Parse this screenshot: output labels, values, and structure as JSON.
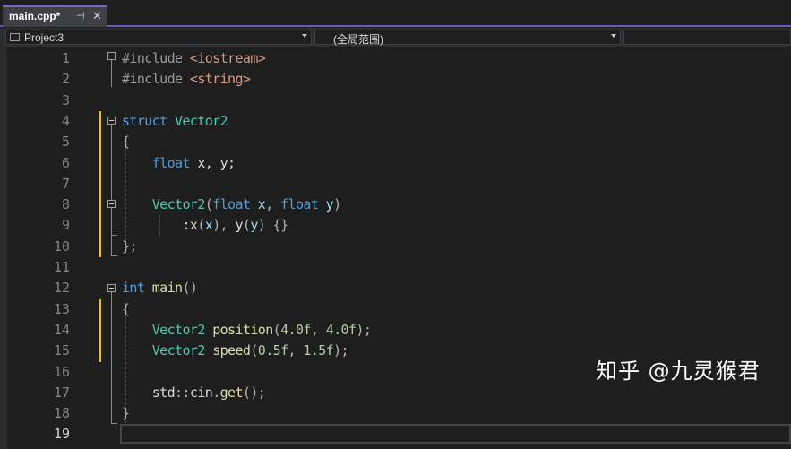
{
  "tab": {
    "title": "main.cpp*",
    "pin_icon": "pin-icon",
    "close_glyph": "✕"
  },
  "nav": {
    "project": "Project3",
    "scope": "(全局范围)"
  },
  "lines": [
    {
      "n": "1",
      "tokens": [
        {
          "c": "pre",
          "t": "#include "
        },
        {
          "c": "str",
          "t": "<iostream>"
        }
      ]
    },
    {
      "n": "2",
      "tokens": [
        {
          "c": "pre",
          "t": "#include "
        },
        {
          "c": "str",
          "t": "<string>"
        }
      ]
    },
    {
      "n": "3",
      "tokens": []
    },
    {
      "n": "4",
      "tokens": [
        {
          "c": "kw",
          "t": "struct "
        },
        {
          "c": "type",
          "t": "Vector2"
        }
      ]
    },
    {
      "n": "5",
      "tokens": [
        {
          "c": "punc",
          "t": "{"
        }
      ]
    },
    {
      "n": "6",
      "tokens": [
        {
          "c": "txt",
          "t": "    "
        },
        {
          "c": "kw",
          "t": "float"
        },
        {
          "c": "txt",
          "t": " x, y;"
        }
      ]
    },
    {
      "n": "7",
      "tokens": []
    },
    {
      "n": "8",
      "tokens": [
        {
          "c": "txt",
          "t": "    "
        },
        {
          "c": "type",
          "t": "Vector2"
        },
        {
          "c": "punc",
          "t": "("
        },
        {
          "c": "kw",
          "t": "float"
        },
        {
          "c": "par",
          "t": " x"
        },
        {
          "c": "punc",
          "t": ", "
        },
        {
          "c": "kw",
          "t": "float"
        },
        {
          "c": "par",
          "t": " y"
        },
        {
          "c": "punc",
          "t": ")"
        }
      ]
    },
    {
      "n": "9",
      "tokens": [
        {
          "c": "txt",
          "t": "        :x"
        },
        {
          "c": "punc",
          "t": "("
        },
        {
          "c": "par",
          "t": "x"
        },
        {
          "c": "punc",
          "t": "), "
        },
        {
          "c": "txt",
          "t": "y"
        },
        {
          "c": "punc",
          "t": "("
        },
        {
          "c": "par",
          "t": "y"
        },
        {
          "c": "punc",
          "t": ") {}"
        }
      ]
    },
    {
      "n": "10",
      "tokens": [
        {
          "c": "punc",
          "t": "};"
        }
      ]
    },
    {
      "n": "11",
      "tokens": []
    },
    {
      "n": "12",
      "tokens": [
        {
          "c": "kw",
          "t": "int "
        },
        {
          "c": "fn",
          "t": "main"
        },
        {
          "c": "punc",
          "t": "()"
        }
      ]
    },
    {
      "n": "13",
      "tokens": [
        {
          "c": "punc",
          "t": "{"
        }
      ]
    },
    {
      "n": "14",
      "tokens": [
        {
          "c": "txt",
          "t": "    "
        },
        {
          "c": "type",
          "t": "Vector2"
        },
        {
          "c": "txt",
          "t": " "
        },
        {
          "c": "fn",
          "t": "position"
        },
        {
          "c": "punc",
          "t": "("
        },
        {
          "c": "num",
          "t": "4.0f"
        },
        {
          "c": "punc",
          "t": ", "
        },
        {
          "c": "num",
          "t": "4.0f"
        },
        {
          "c": "punc",
          "t": ");"
        }
      ]
    },
    {
      "n": "15",
      "tokens": [
        {
          "c": "txt",
          "t": "    "
        },
        {
          "c": "type",
          "t": "Vector2"
        },
        {
          "c": "txt",
          "t": " "
        },
        {
          "c": "fn",
          "t": "speed"
        },
        {
          "c": "punc",
          "t": "("
        },
        {
          "c": "num",
          "t": "0.5f"
        },
        {
          "c": "punc",
          "t": ", "
        },
        {
          "c": "num",
          "t": "1.5f"
        },
        {
          "c": "punc",
          "t": ");"
        }
      ]
    },
    {
      "n": "16",
      "tokens": []
    },
    {
      "n": "17",
      "tokens": [
        {
          "c": "txt",
          "t": "    std"
        },
        {
          "c": "punc",
          "t": "::"
        },
        {
          "c": "txt",
          "t": "cin"
        },
        {
          "c": "punc",
          "t": "."
        },
        {
          "c": "fn",
          "t": "get"
        },
        {
          "c": "punc",
          "t": "();"
        }
      ]
    },
    {
      "n": "18",
      "tokens": [
        {
          "c": "punc",
          "t": "}"
        }
      ]
    },
    {
      "n": "19",
      "tokens": []
    }
  ],
  "watermark": "知乎 @九灵猴君",
  "colors": {
    "accent": "#6b5ab8",
    "change_bar": "#d7c04f",
    "keyword": "#569cd6",
    "type": "#4ec9b0",
    "function": "#dcdcaa",
    "number": "#b5cea8",
    "string": "#d69d85"
  }
}
